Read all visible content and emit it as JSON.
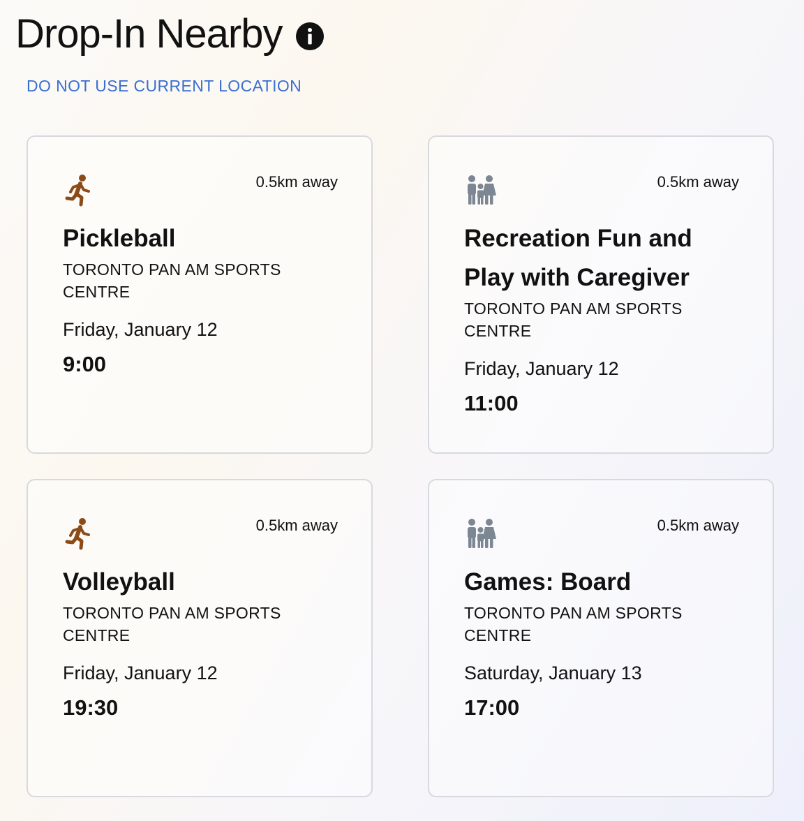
{
  "header": {
    "title": "Drop-In Nearby",
    "info_icon": "info-icon",
    "location_link": "DO NOT USE CURRENT LOCATION"
  },
  "colors": {
    "link": "#3b6fd0",
    "activity_icon_brown": "#8b4b17",
    "family_icon_gray": "#7d8794",
    "card_border": "#d8d9de"
  },
  "cards": [
    {
      "icon": "running-person-icon",
      "distance": "0.5km away",
      "title": "Pickleball",
      "venue": "TORONTO PAN AM SPORTS CENTRE",
      "date": "Friday, January 12",
      "time": "9:00"
    },
    {
      "icon": "family-icon",
      "distance": "0.5km away",
      "title": "Recreation Fun and Play with Caregiver",
      "venue": "TORONTO PAN AM SPORTS CENTRE",
      "date": "Friday, January 12",
      "time": "11:00"
    },
    {
      "icon": "running-person-icon",
      "distance": "0.5km away",
      "title": "Volleyball",
      "venue": "TORONTO PAN AM SPORTS CENTRE",
      "date": "Friday, January 12",
      "time": "19:30"
    },
    {
      "icon": "family-icon",
      "distance": "0.5km away",
      "title": "Games: Board",
      "venue": "TORONTO PAN AM SPORTS CENTRE",
      "date": "Saturday, January 13",
      "time": "17:00"
    }
  ]
}
